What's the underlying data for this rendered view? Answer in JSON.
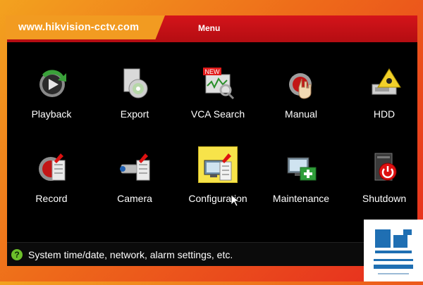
{
  "banner": {
    "site": "www.hikvision-cctv.com"
  },
  "header": {
    "title": "Menu"
  },
  "menu": [
    {
      "label": "Playback",
      "icon": "playback-icon"
    },
    {
      "label": "Export",
      "icon": "export-icon"
    },
    {
      "label": "VCA Search",
      "icon": "vca-search-icon",
      "badge": "NEW"
    },
    {
      "label": "Manual",
      "icon": "manual-icon"
    },
    {
      "label": "HDD",
      "icon": "hdd-icon"
    },
    {
      "label": "Record",
      "icon": "record-icon"
    },
    {
      "label": "Camera",
      "icon": "camera-icon"
    },
    {
      "label": "Configuration",
      "icon": "configuration-icon",
      "selected": true
    },
    {
      "label": "Maintenance",
      "icon": "maintenance-icon"
    },
    {
      "label": "Shutdown",
      "icon": "shutdown-icon"
    }
  ],
  "status": {
    "text": "System time/date, network, alarm settings, etc."
  },
  "colors": {
    "red": "#c8101a",
    "orange": "#f29b21",
    "black": "#000000",
    "blue": "#1f6fb3",
    "selected": "#f7e34a"
  }
}
